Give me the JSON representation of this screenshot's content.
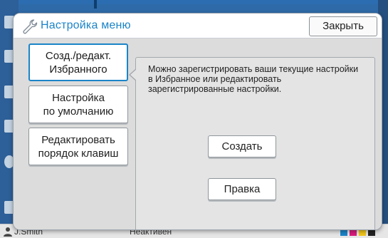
{
  "dialog": {
    "title": "Настройка меню",
    "close_label": "Закрыть"
  },
  "menu": {
    "items": [
      {
        "line1": "Созд./редакт.",
        "line2": "Избранного",
        "active": true
      },
      {
        "line1": "Настройка",
        "line2": "по умолчанию",
        "active": false
      },
      {
        "line1": "Редактировать",
        "line2": "порядок клавиш",
        "active": false
      }
    ]
  },
  "panel": {
    "description": "Можно зарегистрировать ваши текущие настройки в Избранное или редактировать зарегистрированные настройки.",
    "create_label": "Создать",
    "edit_label": "Правка"
  },
  "status_bar": {
    "user": "J.Smith",
    "status": "Неактивен"
  },
  "colors": {
    "accent": "#1b84c8",
    "background": "#2f6aa8"
  }
}
